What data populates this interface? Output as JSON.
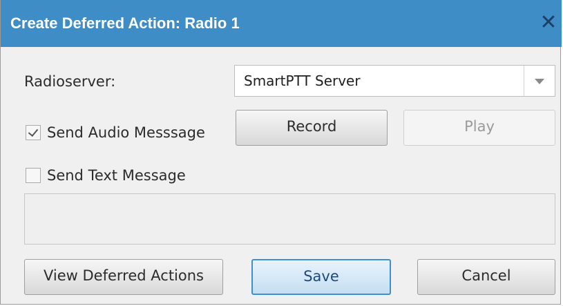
{
  "dialog": {
    "title": "Create Deferred Action: Radio 1",
    "close_symbol": "✕"
  },
  "radioserver": {
    "label": "Radioserver:",
    "selected": "SmartPTT Server"
  },
  "audio": {
    "checkbox_label": "Send Audio Messsage",
    "checked": true,
    "record_label": "Record",
    "play_label": "Play"
  },
  "text_message": {
    "checkbox_label": "Send Text Message",
    "checked": false,
    "value": ""
  },
  "footer": {
    "view_label": "View Deferred Actions",
    "save_label": "Save",
    "cancel_label": "Cancel"
  },
  "colors": {
    "titlebar": "#3f8dc6",
    "primary_border": "#3d8fd0"
  },
  "icons": {
    "close": "close-icon",
    "dropdown": "chevron-down-icon",
    "check": "checkmark-icon"
  }
}
